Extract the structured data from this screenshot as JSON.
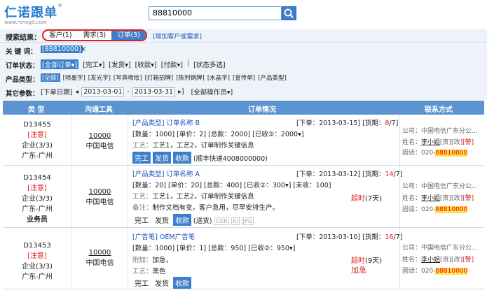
{
  "logo": {
    "name": "仁诺跟单",
    "reg": "®",
    "site": "www.renogd.com"
  },
  "search": {
    "value": "88810000",
    "icon": "search-icon"
  },
  "results": {
    "label": "搜索结果：",
    "tabs": [
      {
        "label": "客户(1)"
      },
      {
        "label": "需求(3)"
      },
      {
        "label": "订单(3)"
      }
    ],
    "add_link": "[增加客户或需求]"
  },
  "filters": {
    "keyword_label": "关 键 词：",
    "keyword_value": "[88810000]",
    "keyword_clear": "×",
    "status_label": "订单状态：",
    "status_items": [
      "[全部订单▾]",
      "[完工▾]",
      "[发货▾]",
      "[收款▾]",
      "[付款▾]",
      "|",
      "[状态多选]"
    ],
    "type_label": "产品类型：",
    "type_items": [
      "[全部]",
      "[喷墨字]",
      "[发光字]",
      "[写真喷绘]",
      "[灯箱招牌]",
      "[陈列钢牌]",
      "[水晶字]",
      "[宣传单]",
      "[产品类型]"
    ],
    "other_label": "其它参数：",
    "date_label": "[下单日期]",
    "date_prev": "◂",
    "date_start": "2013-03-01",
    "date_sep": "-",
    "date_end": "2013-03-31",
    "date_next": "▸]",
    "operator": "[全部操作员▾]"
  },
  "table": {
    "headers": [
      "类 型",
      "沟通工具",
      "订单情况",
      "联系方式"
    ],
    "rows": [
      {
        "id": "D13455",
        "note": "[注意]",
        "biz": "企业(3/3)",
        "region": "广东-广州",
        "staff": "",
        "channel_num": "10000",
        "channel_name": "中国电信",
        "product": "[产品类型] 订单名称 B",
        "order_date": "[下单：2013-03-15]",
        "delivery_pre": "[货期：",
        "delivery_num": "8",
        "delivery_post": "/7]",
        "line1": "[数量：1000] [单价：2] [总款：2000] [已收②：2000▾]",
        "line2_label": "工艺：",
        "line2": "工艺1，工艺2，订单制作关键信息",
        "remark_label": "",
        "remark": "",
        "buttons": [
          "完工",
          "发货",
          "收款"
        ],
        "extra": "(顺丰快递4008000000)",
        "overdue": "",
        "overdue_days": "",
        "urgent": "",
        "company": "公司：中国电信广东分公...",
        "contact_pre": "姓名：",
        "contact_name": "李小姐",
        "contact_tags": "[资][改]",
        "contact_flag": "[警]",
        "phone_pre": "固话：020-",
        "phone_hl": "88810000"
      },
      {
        "id": "D13454",
        "note": "[注意]",
        "biz": "企业(3/3)",
        "region": "广东-广州",
        "staff": "业务员",
        "channel_num": "10000",
        "channel_name": "中国电信",
        "product": "[产品类型] 订单名称 A",
        "order_date": "[下单：2013-03-12]",
        "delivery_pre": "[货期：",
        "delivery_num": "14",
        "delivery_post": "/7]",
        "line1": "[数量：20] [单价：20] [总款：400] [已收②：300▾] [未收：100]",
        "line2_label": "工艺：",
        "line2": "工艺1，工艺2，订单制作关键信息",
        "remark_label": "备注：",
        "remark": "制作文档有变，客户急用，尽早安排生产。",
        "buttons": [
          "完工",
          "发货",
          "收款"
        ],
        "extra": "(送货)",
        "tags": [
          "CDR",
          "AI",
          "JPG"
        ],
        "overdue": "超时",
        "overdue_days": "(7天)",
        "urgent": "",
        "company": "公司：中国电信广东分公...",
        "contact_pre": "姓名：",
        "contact_name": "李小姐",
        "contact_tags": "[资][改]",
        "contact_flag": "[警]",
        "phone_pre": "固话：020-",
        "phone_hl": "88810000"
      },
      {
        "id": "D13453",
        "note": "[注意]",
        "biz": "企业(3/3)",
        "region": "广东-广州",
        "staff": "",
        "channel_num": "10000",
        "channel_name": "中国电信",
        "product": "[广告笔] OEM广告笔",
        "order_date": "[下单：2013-03-10]",
        "delivery_pre": "[货期：",
        "delivery_num": "16",
        "delivery_post": "/7]",
        "line1": "[数量：1000] [单价：1] [总款：950] [已收②：950▾]",
        "line2_label": "附加：",
        "line2": "加急，",
        "remark_label": "工艺：",
        "remark": "黑色",
        "buttons": [
          "完工",
          "发货",
          "收款"
        ],
        "extra": "",
        "overdue": "超时",
        "overdue_days": "(9天)",
        "urgent": "加急",
        "company": "公司：中国电信广东分公...",
        "contact_pre": "姓名：",
        "contact_name": "李小姐",
        "contact_tags": "[资][改]",
        "contact_flag": "[警]",
        "phone_pre": "固话：020-",
        "phone_hl": "88810000"
      }
    ]
  }
}
